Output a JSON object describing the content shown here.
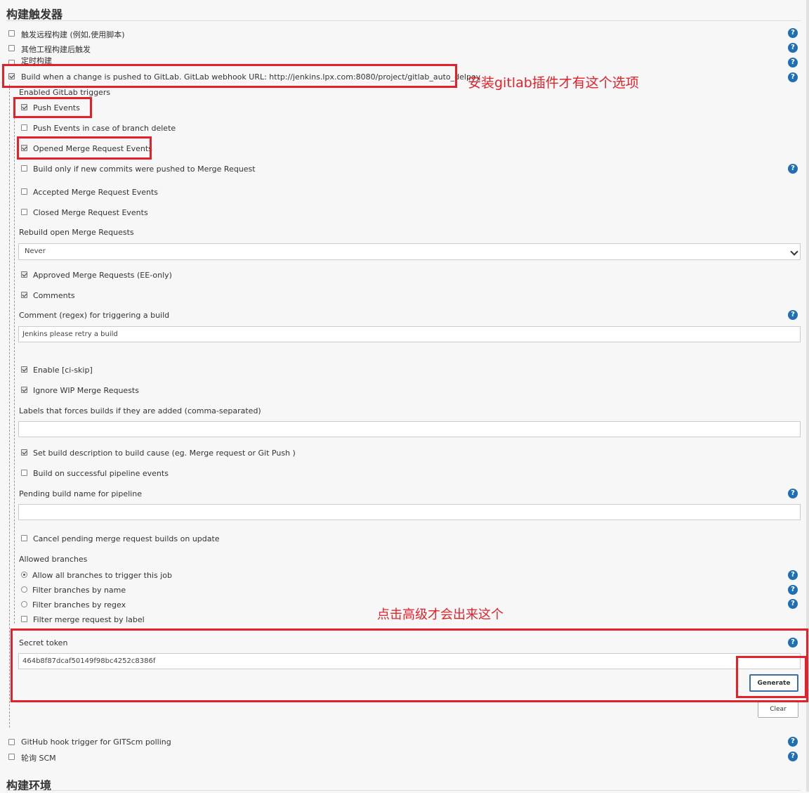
{
  "section_build_triggers": "构建触发器",
  "section_build_env": "构建环境",
  "top_triggers": [
    {
      "label": "触发远程构建 (例如,使用脚本)",
      "checked": false
    },
    {
      "label": "其他工程构建后触发",
      "checked": false
    },
    {
      "label": "定时构建",
      "checked": false
    },
    {
      "label": "Build when a change is pushed to GitLab. GitLab webhook URL: http://jenkins.lpx.com:8080/project/gitlab_auto_delpoy",
      "checked": true
    }
  ],
  "gitlab": {
    "enabled_triggers_label": "Enabled GitLab triggers",
    "push_events": "Push Events",
    "push_events_branch_delete": "Push Events in case of branch delete",
    "opened_mr_events": "Opened Merge Request Events",
    "build_only_new_commits": "Build only if new commits were pushed to Merge Request",
    "accepted_mr_events": "Accepted Merge Request Events",
    "closed_mr_events": "Closed Merge Request Events",
    "rebuild_open_mr_label": "Rebuild open Merge Requests",
    "rebuild_open_mr_value": "Never",
    "approved_mr": "Approved Merge Requests (EE-only)",
    "comments": "Comments",
    "comment_regex_label": "Comment (regex) for triggering a build",
    "comment_regex_value": "Jenkins please retry a build",
    "enable_ci_skip": "Enable [ci-skip]",
    "ignore_wip": "Ignore WIP Merge Requests",
    "labels_force_label": "Labels that forces builds if they are added (comma-separated)",
    "labels_force_value": "",
    "set_build_desc": "Set build description to build cause (eg. Merge request or Git Push )",
    "build_on_pipeline": "Build on successful pipeline events",
    "pending_build_name_label": "Pending build name for pipeline",
    "pending_build_name_value": "",
    "cancel_pending": "Cancel pending merge request builds on update",
    "allowed_branches_label": "Allowed branches",
    "allow_all_branches": "Allow all branches to trigger this job",
    "filter_by_name": "Filter branches by name",
    "filter_by_regex": "Filter branches by regex",
    "filter_mr_by_label": "Filter merge request by label",
    "secret_token_label": "Secret token",
    "secret_token_value": "464b8f87dcaf50149f98bc4252c8386f",
    "generate_button": "Generate",
    "clear_button": "Clear"
  },
  "bottom_triggers": [
    {
      "label": "GitHub hook trigger for GITScm polling",
      "checked": false
    },
    {
      "label": "轮询 SCM",
      "checked": false
    }
  ],
  "annotations": {
    "gitlab_plugin_note": "安装gitlab插件才有这个选项",
    "advanced_note": "点击高级才会出来这个"
  },
  "help_glyph": "?",
  "colors": {
    "annotation_red": "#e4212b",
    "help_blue": "#1f6fb5"
  }
}
